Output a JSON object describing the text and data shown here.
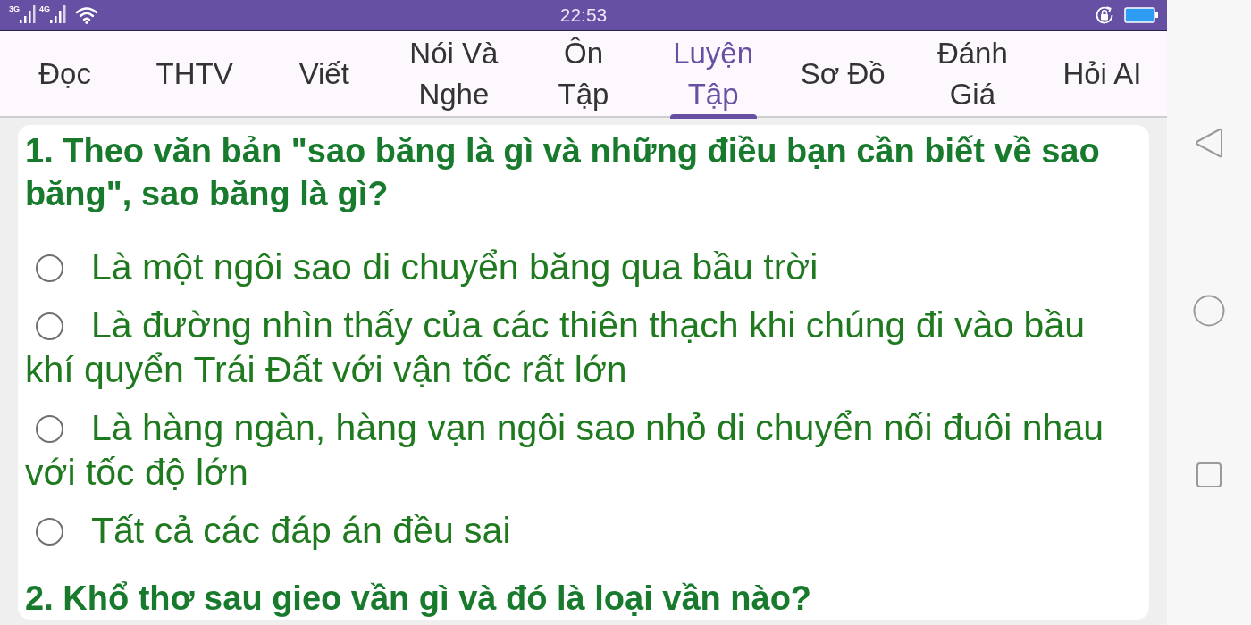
{
  "status_bar": {
    "networks": [
      {
        "label": "3G"
      },
      {
        "label": "4G"
      }
    ],
    "time": "22:53"
  },
  "tabs": [
    {
      "label": "Đọc",
      "selected": false
    },
    {
      "label": "THTV",
      "selected": false
    },
    {
      "label": "Viết",
      "selected": false
    },
    {
      "label": "Nói Và Nghe",
      "selected": false
    },
    {
      "label": "Ôn Tập",
      "selected": false
    },
    {
      "label": "Luyện Tập",
      "selected": true
    },
    {
      "label": "Sơ Đồ",
      "selected": false
    },
    {
      "label": "Đánh Giá",
      "selected": false
    },
    {
      "label": "Hỏi AI",
      "selected": false
    }
  ],
  "questions": [
    {
      "text": "1. Theo văn bản \"sao băng là gì và những điều bạn cần biết về sao băng\", sao băng là gì?",
      "options": [
        {
          "text": "Là một ngôi sao di chuyển băng qua bầu trời",
          "selected": false
        },
        {
          "text": "Là đường nhìn thấy của các thiên thạch khi chúng đi vào bầu khí quyển Trái Đất với vận tốc rất lớn",
          "selected": false
        },
        {
          "text": "Là hàng ngàn, hàng vạn ngôi sao nhỏ di chuyển nối đuôi nhau với tốc độ lớn",
          "selected": false
        },
        {
          "text": "Tất cả các đáp án đều sai",
          "selected": false
        }
      ]
    },
    {
      "text": "2. Khổ thơ sau gieo vần gì và đó là loại vần nào?"
    }
  ]
}
